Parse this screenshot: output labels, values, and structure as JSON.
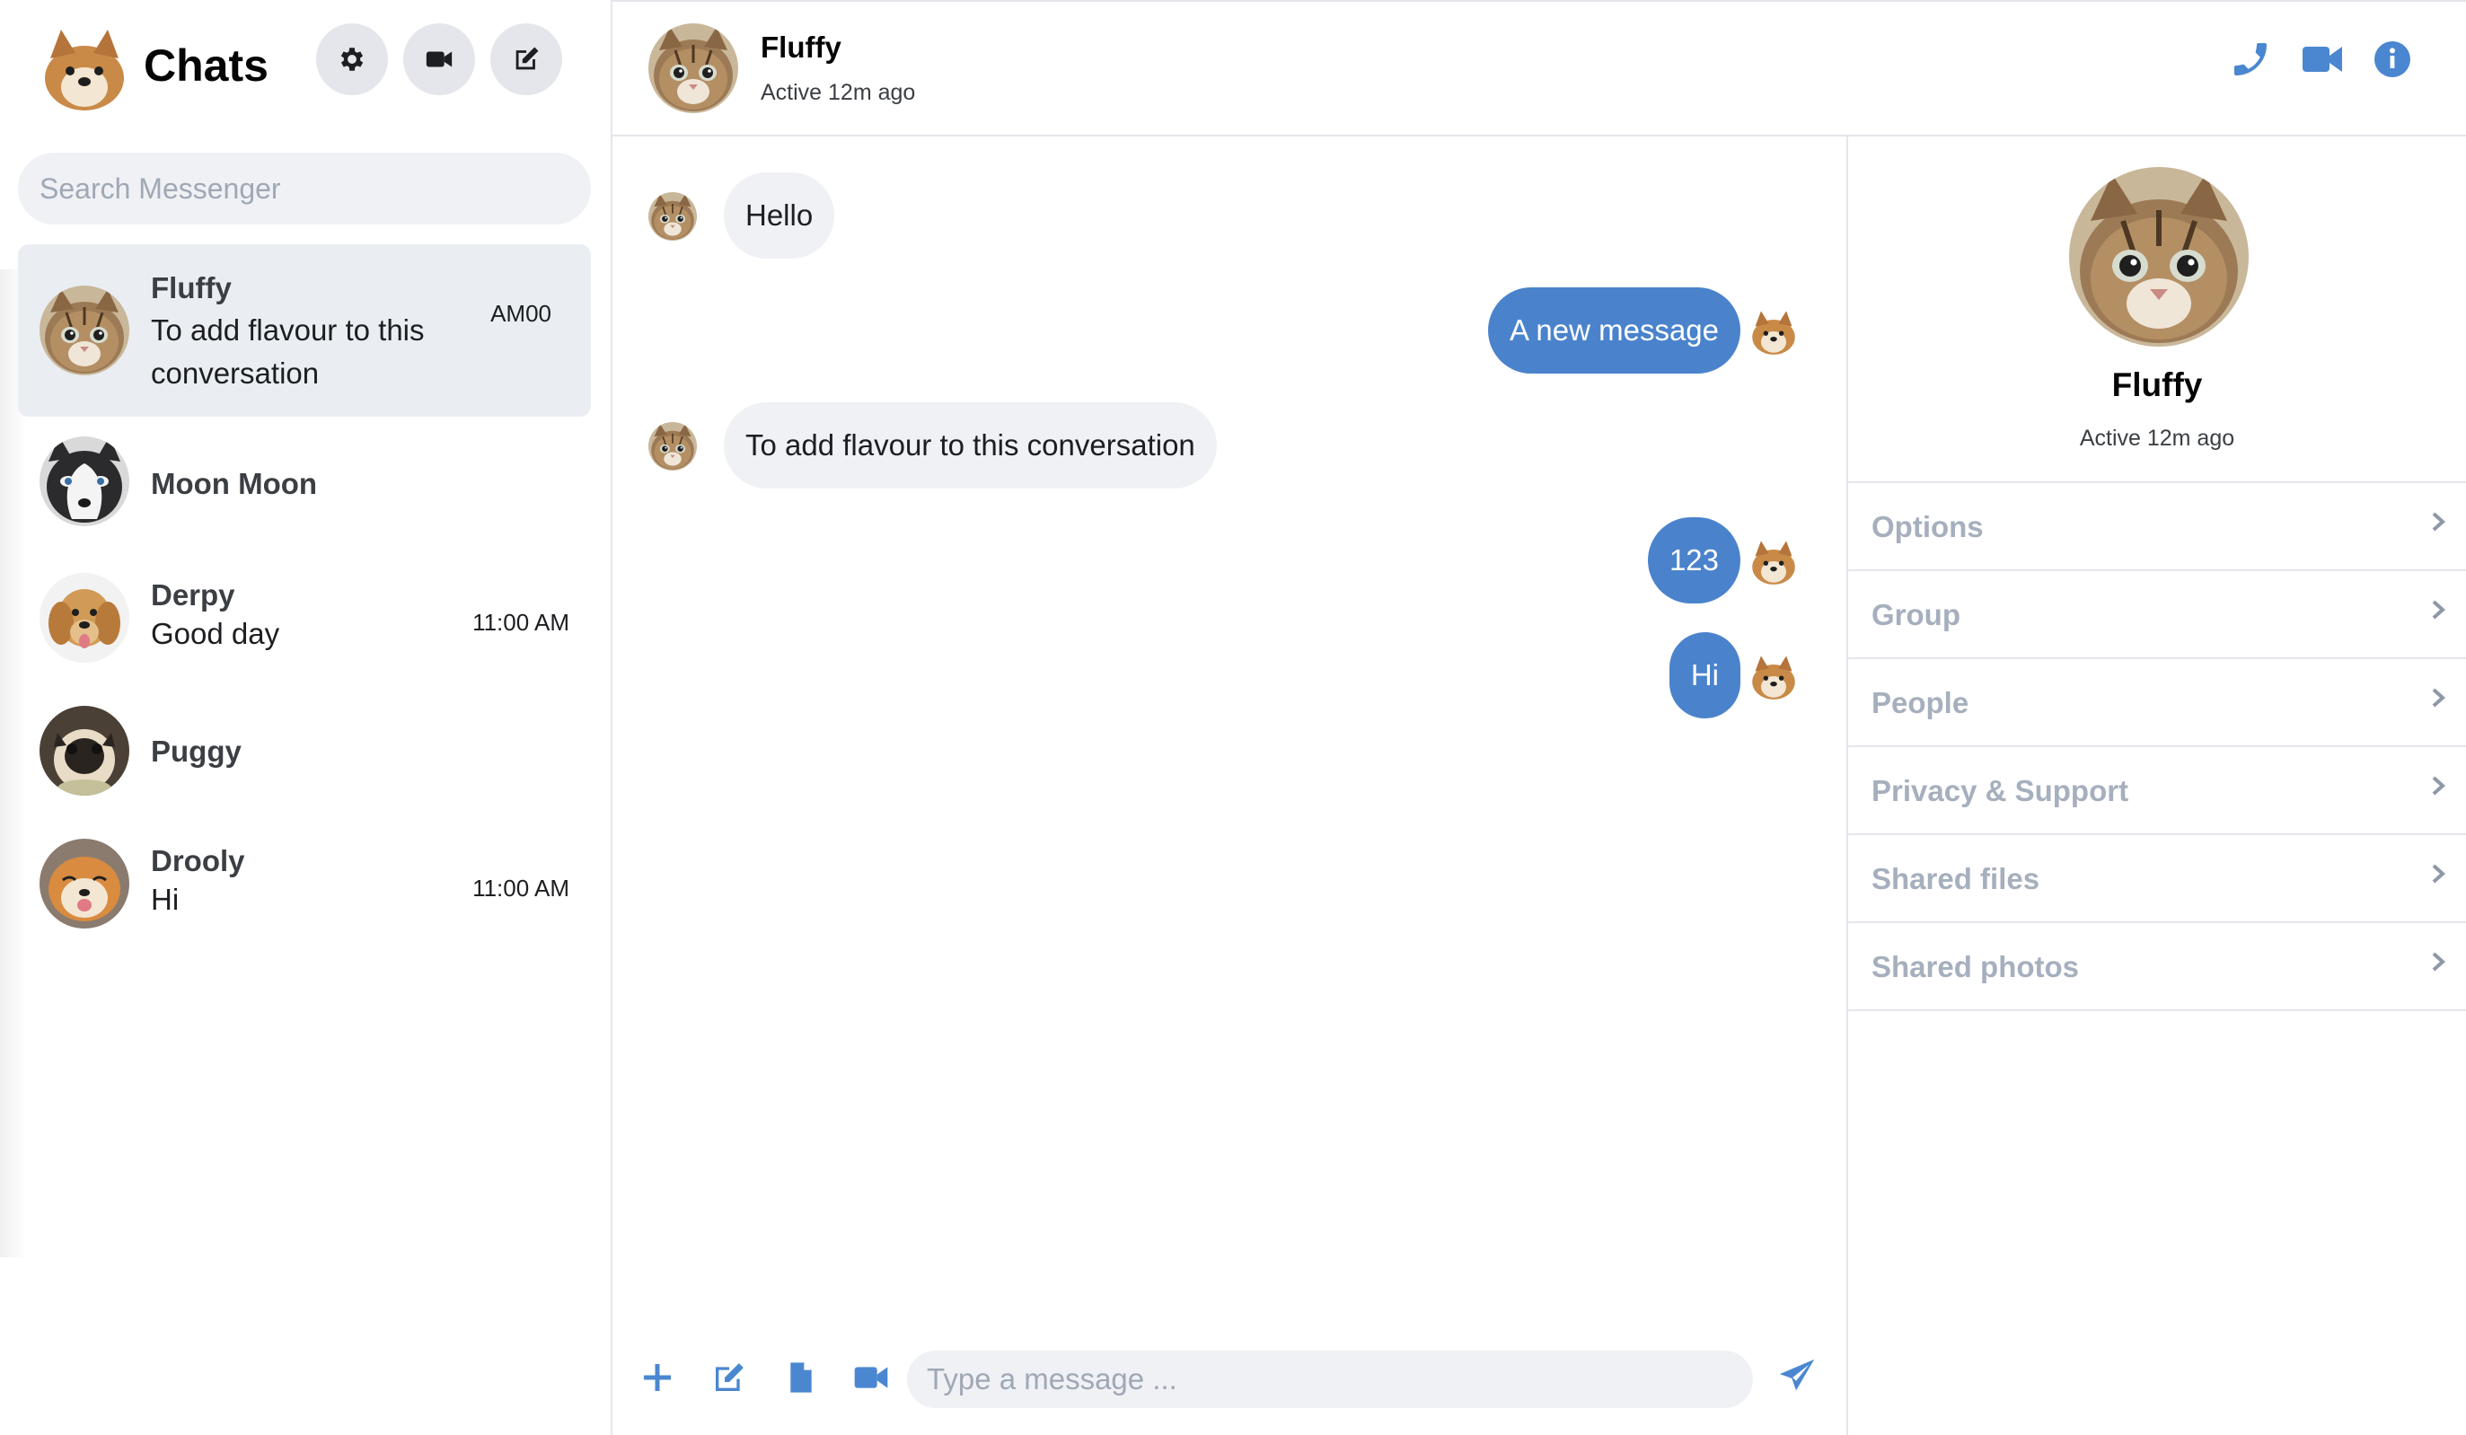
{
  "sidebar": {
    "title": "Chats",
    "search_placeholder": "Search Messenger",
    "buttons": [
      {
        "name": "settings",
        "icon": "gear-icon"
      },
      {
        "name": "video",
        "icon": "video-camera-icon"
      },
      {
        "name": "compose",
        "icon": "edit-icon"
      }
    ],
    "conversations": [
      {
        "name": "Fluffy",
        "preview": "To add flavour to this conversation",
        "time": "AM00",
        "active": true,
        "avatar": "kitten"
      },
      {
        "name": "Moon Moon",
        "preview": "",
        "time": "",
        "active": false,
        "avatar": "husky"
      },
      {
        "name": "Derpy",
        "preview": "Good day",
        "time": "11:00 AM",
        "active": false,
        "avatar": "golden-retriever"
      },
      {
        "name": "Puggy",
        "preview": "",
        "time": "",
        "active": false,
        "avatar": "pug"
      },
      {
        "name": "Drooly",
        "preview": "Hi",
        "time": "11:00 AM",
        "active": false,
        "avatar": "shiba-puppy"
      }
    ]
  },
  "chat": {
    "contact_name": "Fluffy",
    "contact_status": "Active 12m ago",
    "header_icons": [
      "phone-icon",
      "video-camera-icon",
      "info-icon"
    ],
    "messages": [
      {
        "text": "Hello",
        "direction": "in"
      },
      {
        "text": "A new message",
        "direction": "out"
      },
      {
        "text": "To add flavour to this conversation",
        "direction": "in"
      },
      {
        "text": "123",
        "direction": "out"
      },
      {
        "text": "Hi",
        "direction": "out"
      }
    ],
    "composer": {
      "placeholder": "Type a message ...",
      "icons": [
        "plus-icon",
        "edit-icon",
        "file-icon",
        "video-camera-icon",
        "send-icon"
      ]
    }
  },
  "info_panel": {
    "name": "Fluffy",
    "status": "Active 12m ago",
    "sections": [
      "Options",
      "Group",
      "People",
      "Privacy & Support",
      "Shared files",
      "Shared photos"
    ]
  },
  "colors": {
    "accent": "#4a87d0",
    "outgoing_bubble": "#4a83cc",
    "incoming_bubble": "#eff1f5",
    "active_conversation": "#eaeef3",
    "muted_label": "#a6afbd"
  }
}
